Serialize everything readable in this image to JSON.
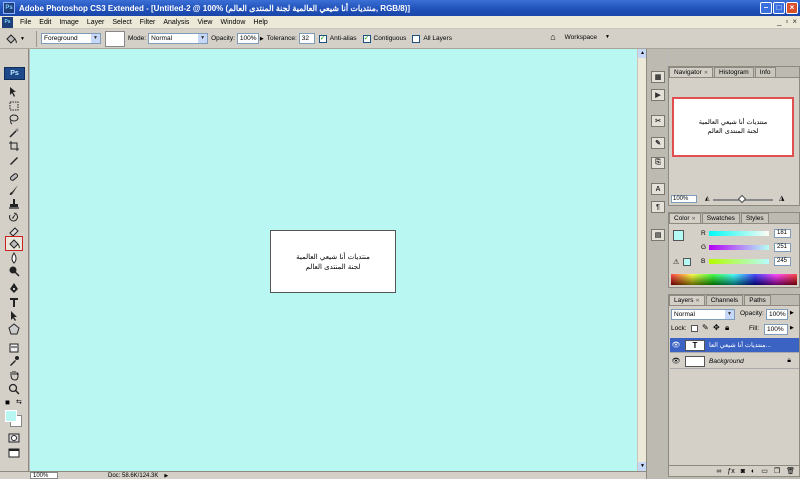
{
  "titlebar": {
    "title": "Adobe Photoshop CS3 Extended - [Untitled-2 @ 100% (منتديات أنا شيعي العالمية لجنة المنتدى العالم, RGB/8)]",
    "app_icon": "Ps"
  },
  "menubar": {
    "items": [
      "File",
      "Edit",
      "Image",
      "Layer",
      "Select",
      "Filter",
      "Analysis",
      "View",
      "Window",
      "Help"
    ]
  },
  "options": {
    "fill_source": "Foreground",
    "mode_label": "Mode:",
    "mode_value": "Normal",
    "opacity_label": "Opacity:",
    "opacity_value": "100%",
    "tolerance_label": "Tolerance:",
    "tolerance_value": "32",
    "antialias_label": "Anti-alias",
    "contiguous_label": "Contiguous",
    "all_layers_label": "All Layers",
    "workspace_label": "Workspace"
  },
  "toolbox": {
    "logo": "Ps",
    "active_tool": "paint-bucket",
    "foreground_color": "#b9f7f2",
    "background_color": "#ffffff"
  },
  "canvas": {
    "background_color": "#b9f7f2",
    "document_lines": [
      "منتديات أنا شيعي العالمية",
      "لجنة المنتدى العالم"
    ]
  },
  "statusbar": {
    "zoom": "100%",
    "doc_info": "Doc: 58.6K/124.3K"
  },
  "navigator": {
    "tabs": [
      "Navigator",
      "Histogram",
      "Info"
    ],
    "zoom": "100%",
    "preview_lines": [
      "منتديات أنا شيعي العالمية",
      "لجنة المنتدى العالم"
    ]
  },
  "color_panel": {
    "tabs": [
      "Color",
      "Swatches",
      "Styles"
    ],
    "channels": [
      {
        "label": "R",
        "value": "181"
      },
      {
        "label": "G",
        "value": "251"
      },
      {
        "label": "B",
        "value": "245"
      }
    ],
    "swatch": "#b5fbf5"
  },
  "layers_panel": {
    "tabs": [
      "Layers",
      "Channels",
      "Paths"
    ],
    "blend_mode": "Normal",
    "opacity_label": "Opacity:",
    "opacity_value": "100%",
    "lock_label": "Lock:",
    "fill_label": "Fill:",
    "fill_value": "100%",
    "layers": [
      {
        "name": "منتديات أنا شيعي العا...",
        "thumb": "T",
        "selected": true
      },
      {
        "name": "Background",
        "thumb": "",
        "selected": false
      }
    ]
  }
}
